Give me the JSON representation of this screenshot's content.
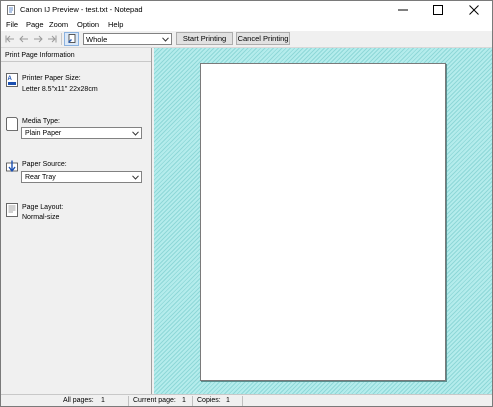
{
  "window": {
    "title": "Canon IJ Preview - test.txt - Notepad",
    "icon": "printer-preview-icon",
    "controls": [
      "minimize-icon",
      "maximize-icon",
      "close-icon"
    ]
  },
  "menu": [
    "File",
    "Page",
    "Zoom",
    "Option",
    "Help"
  ],
  "toolbar": {
    "nav_icons": [
      "first-page-icon",
      "previous-page-icon",
      "next-page-icon",
      "last-page-icon"
    ],
    "page_icon": "page-edit-icon",
    "zoom_value": "Whole",
    "start_label": "Start Printing",
    "cancel_label": "Cancel Printing"
  },
  "info_panel": {
    "title": "Print Page Information",
    "paper_size_label": "Printer Paper Size:",
    "paper_size_value": "Letter 8.5\"x11\" 22x28cm",
    "media_type_label": "Media Type:",
    "media_type_value": "Plain Paper",
    "paper_source_label": "Paper Source:",
    "paper_source_value": "Rear Tray",
    "page_layout_label": "Page Layout:",
    "page_layout_value": "Normal-size"
  },
  "status": {
    "all_pages_label": "All pages:",
    "all_pages_value": "1",
    "current_page_label": "Current page:",
    "current_page_value": "1",
    "copies_label": "Copies:",
    "copies_value": "1"
  },
  "colors": {
    "preview_background": "#b4ecec",
    "button_highlight": "#dbe8f7"
  }
}
